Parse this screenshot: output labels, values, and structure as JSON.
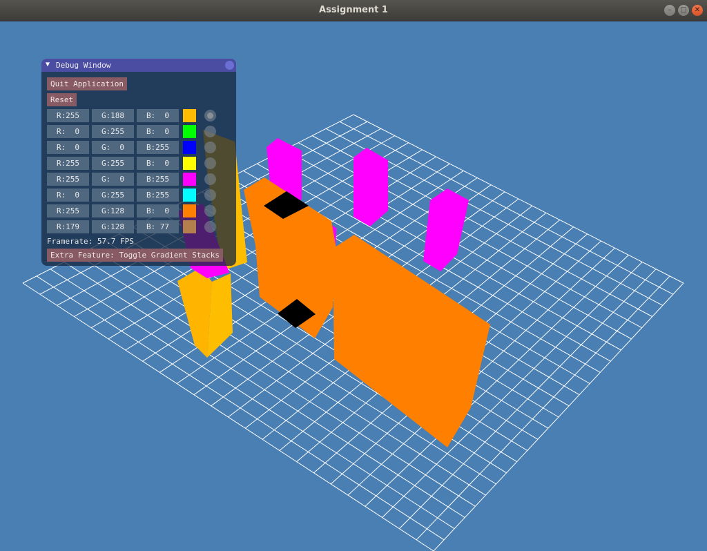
{
  "window": {
    "title": "Assignment 1"
  },
  "debug_window": {
    "title": "Debug Window",
    "quit_label": "Quit Application",
    "reset_label": "Reset",
    "framerate_label": "Framerate: 57.7 FPS",
    "extra_feature_label": "Extra Feature: Toggle Gradient Stacks",
    "color_rows": [
      {
        "r": "R:255",
        "g": "G:188",
        "b": "B:  0",
        "color": "#ffbc00",
        "selected": true
      },
      {
        "r": "R:  0",
        "g": "G:255",
        "b": "B:  0",
        "color": "#00ff00",
        "selected": false
      },
      {
        "r": "R:  0",
        "g": "G:  0",
        "b": "B:255",
        "color": "#0000ff",
        "selected": false
      },
      {
        "r": "R:255",
        "g": "G:255",
        "b": "B:  0",
        "color": "#ffff00",
        "selected": false
      },
      {
        "r": "R:255",
        "g": "G:  0",
        "b": "B:255",
        "color": "#ff00ff",
        "selected": false
      },
      {
        "r": "R:  0",
        "g": "G:255",
        "b": "B:255",
        "color": "#00ffff",
        "selected": false
      },
      {
        "r": "R:255",
        "g": "G:128",
        "b": "B:  0",
        "color": "#ff8000",
        "selected": false
      },
      {
        "r": "R:179",
        "g": "G:128",
        "b": "B: 77",
        "color": "#b3804d",
        "selected": false
      }
    ]
  },
  "scene": {
    "background_color": "#4a7fb3",
    "grid_color": "#ffffff",
    "objects": [
      {
        "name": "amber-pillar",
        "color": "#ffbc00"
      },
      {
        "name": "magenta-pillar",
        "color": "#ff00ff"
      },
      {
        "name": "orange-block",
        "color": "#ff8000"
      },
      {
        "name": "black-tile",
        "color": "#000000"
      }
    ]
  }
}
